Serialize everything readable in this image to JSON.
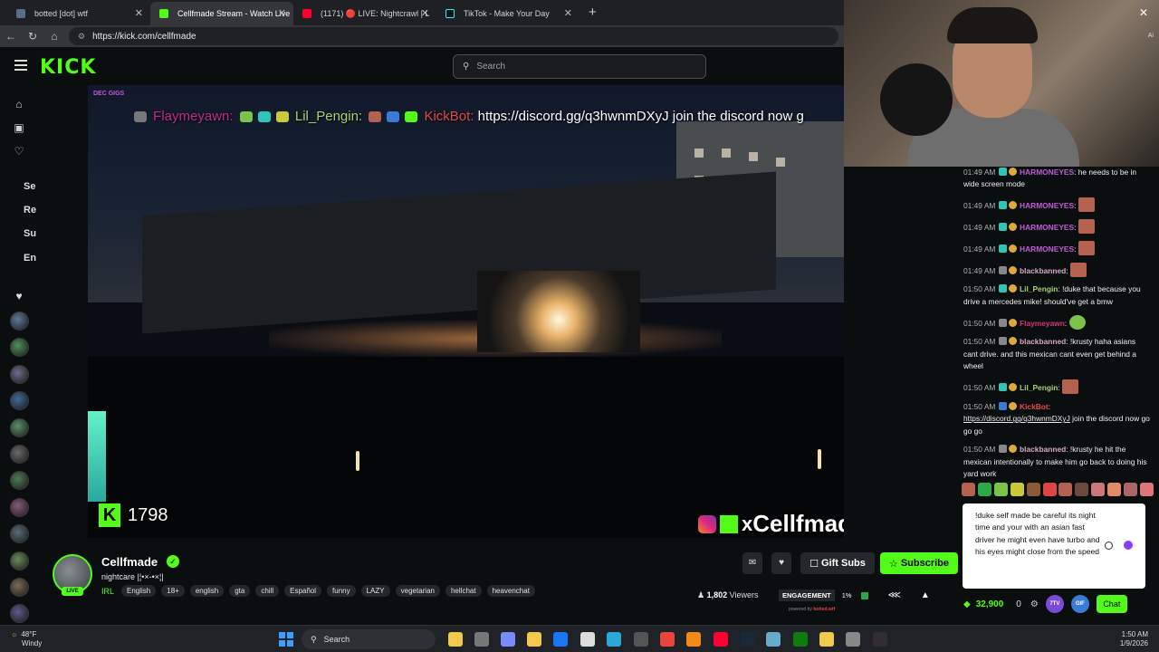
{
  "browser": {
    "tabs": [
      {
        "label": "botted [dot] wtf",
        "active": false,
        "close": "✕"
      },
      {
        "label": "Cellfmade Stream - Watch Live",
        "active": true,
        "close": "✕"
      },
      {
        "label": "(1171) 🔴 LIVE: Nightcrawl | L",
        "active": false,
        "close": "✕"
      },
      {
        "label": "TikTok - Make Your Day",
        "active": false,
        "close": "✕"
      }
    ],
    "new_tab": "+",
    "url": "https://kick.com/cellfmade"
  },
  "header": {
    "logo": "KICK",
    "search_placeholder": "Search"
  },
  "sidebar": {
    "labels": [
      "Se",
      "Re",
      "Su",
      "En"
    ],
    "avatars": [
      "#5d7a9a",
      "#4f8f5a",
      "#6b6b8a",
      "#3f6a9a",
      "#5a8f6a",
      "#6a6a6a",
      "#4f7a5a",
      "#8a5a7a",
      "#5a6a7a",
      "#6a8a5a",
      "#7a6a5a",
      "#5a5a8a"
    ]
  },
  "video": {
    "overlay_tag": "DEC GIGS",
    "overlay_chat": {
      "user1": "Flaymeyawn:",
      "user2": "Lil_Pengin:",
      "user3": "KickBot:",
      "message": "https://discord.gg/q3hwnmDXyJ join the discord now g"
    },
    "follower_count": "1798",
    "brand_text": "Cellfmade"
  },
  "webcam": {
    "close": "✕",
    "side_text": "Ai"
  },
  "chat": {
    "messages": [
      {
        "time": "01:49 AM",
        "user": "HARMONEYES",
        "color": "#c05ad8",
        "badge": "#2ec4b6",
        "text": "he needs to be in wide screen mode",
        "emote": false
      },
      {
        "time": "01:49 AM",
        "user": "HARMONEYES",
        "color": "#c05ad8",
        "badge": "#2ec4b6",
        "text": "",
        "emote": true
      },
      {
        "time": "01:49 AM",
        "user": "HARMONEYES",
        "color": "#c05ad8",
        "badge": "#2ec4b6",
        "text": "",
        "emote": true
      },
      {
        "time": "01:49 AM",
        "user": "HARMONEYES",
        "color": "#c05ad8",
        "badge": "#2ec4b6",
        "text": "",
        "emote": true
      },
      {
        "time": "01:49 AM",
        "user": "blackbanned",
        "color": "#d8a8c0",
        "badge": "#888888",
        "text": "",
        "emote": true
      },
      {
        "time": "01:50 AM",
        "user": "Lil_Pengin",
        "color": "#a9d16e",
        "badge": "#2ec4b6",
        "text": "!duke that because you drive a mercedes mike! should've get a bmw",
        "emote": false
      },
      {
        "time": "01:50 AM",
        "user": "Flaymeyawn",
        "color": "#d4327a",
        "badge": "#888888",
        "text": "",
        "emote": true
      },
      {
        "time": "01:50 AM",
        "user": "blackbanned",
        "color": "#d8a8c0",
        "badge": "#888888",
        "text": "!krusty haha asians cant drive. and this mexican cant even get behind a wheel",
        "emote": false
      },
      {
        "time": "01:50 AM",
        "user": "Lil_Pengin",
        "color": "#a9d16e",
        "badge": "#2ec4b6",
        "text": "",
        "emote": true
      },
      {
        "time": "01:50 AM",
        "user": "KickBot",
        "color": "#e14a4a",
        "badge": "#3a7bd5",
        "text": "",
        "link": "https://discord.gg/q3hwnmDXyJ",
        "after": "join the discord now go go go",
        "emote": false
      },
      {
        "time": "01:50 AM",
        "user": "blackbanned",
        "color": "#d8a8c0",
        "badge": "#888888",
        "text": "!krusty he hit the mexican intentionally to make him go back to doing his yard work",
        "emote": false
      }
    ],
    "input_text": "!duke self made be careful its night time and your with an asian fast driver he might even have turbo and his eyes might close from the speed",
    "points": "32,900",
    "zero": "0",
    "chat_button": "Chat",
    "round1": "7TV",
    "round2": "GIF"
  },
  "channel": {
    "name": "Cellfmade",
    "title": "nightcare |¦•×-•×¦|",
    "live": "LIVE",
    "category": "IRL",
    "tags": [
      "English",
      "18+",
      "english",
      "gta",
      "chill",
      "Español",
      "funny",
      "LAZY",
      "vegetarian",
      "hellchat",
      "heavenchat"
    ],
    "gift_label": "Gift Subs",
    "subscribe_label": "Subscribe",
    "viewers": "1,802",
    "viewers_label": "Viewers",
    "engagement_label": "ENGAGEMENT",
    "engagement_pct": "1%",
    "powered": "powered by",
    "powered_brand": "botted.wtf"
  },
  "taskbar": {
    "temp": "48°F",
    "weather": "Windy",
    "search": "Search",
    "time": "1:50 AM",
    "date": "1/9/2026"
  },
  "colors": {
    "kick_green": "#53fc18",
    "background": "#0b0e0f"
  }
}
